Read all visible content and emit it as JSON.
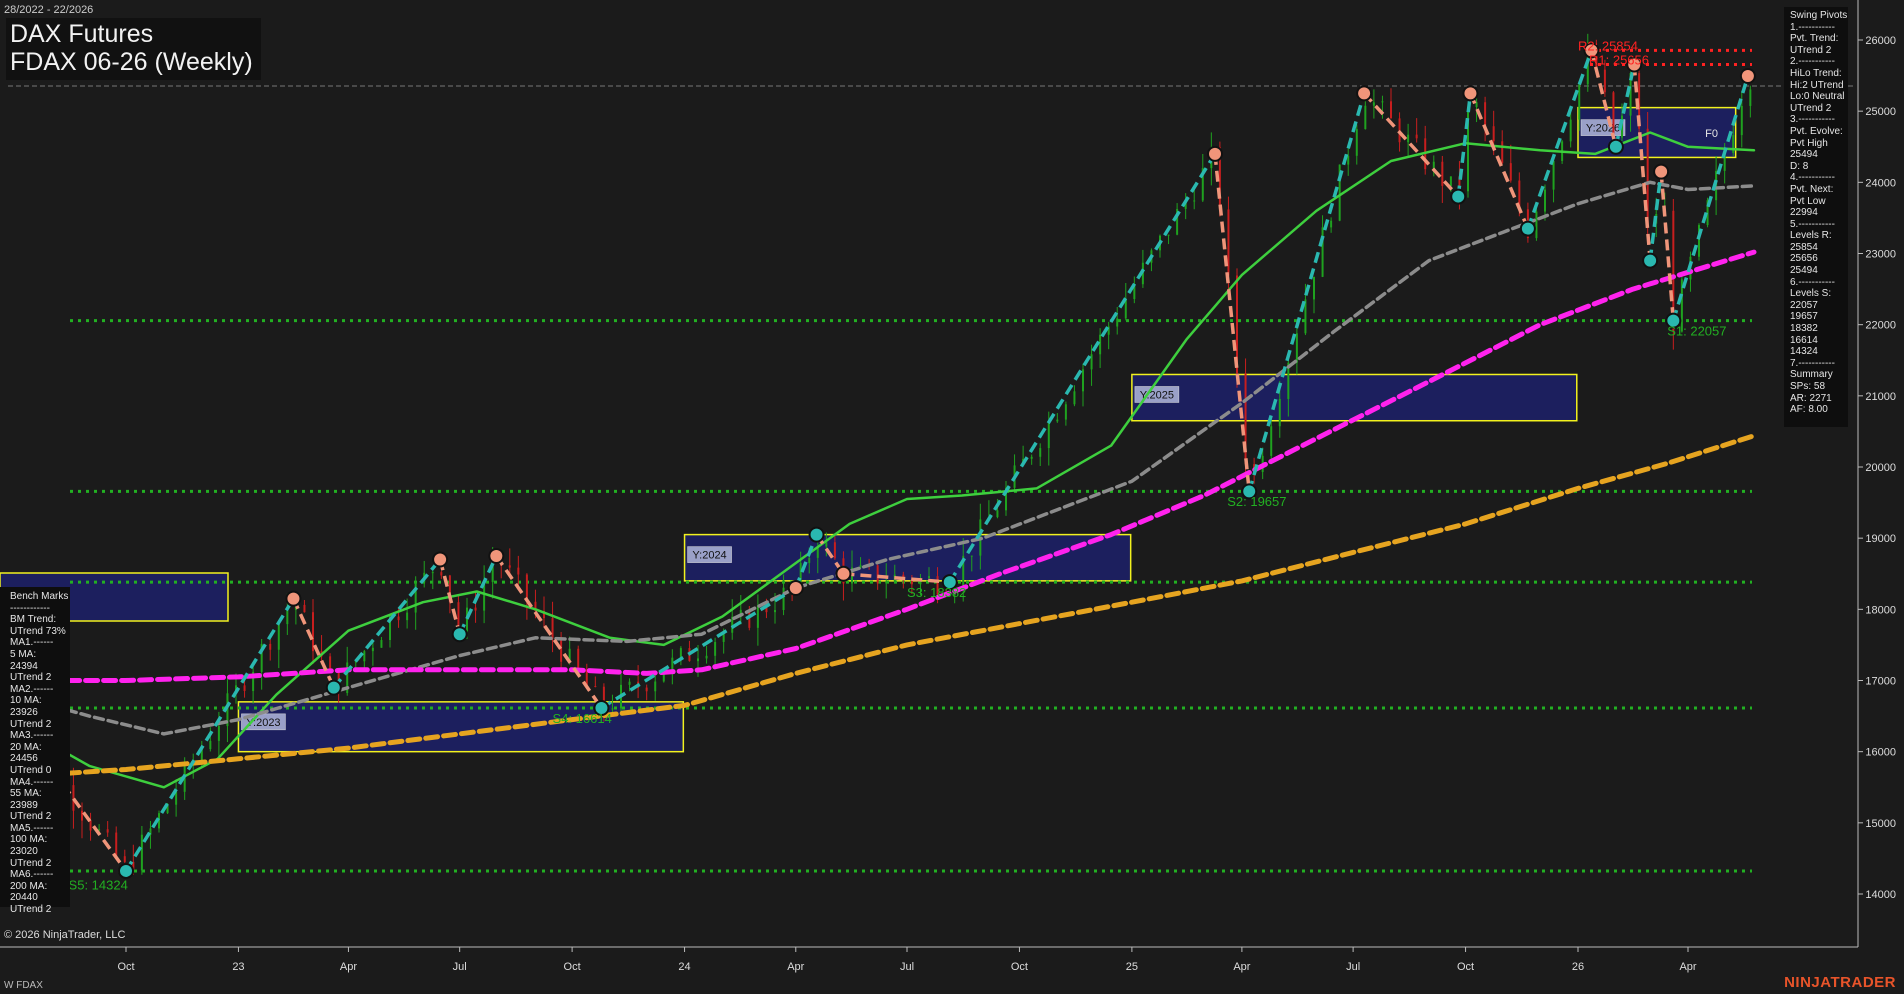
{
  "header": {
    "date_range": "28/2022 - 22/2026",
    "title_line1": "DAX Futures",
    "title_line2": "FDAX 06-26 (Weekly)"
  },
  "footer": {
    "copyright": "© 2026 NinjaTrader, LLC",
    "instrument": "W FDAX",
    "brand": "NINJATRADER"
  },
  "bench_marks": [
    "Bench Marks",
    "------------",
    "BM Trend:",
    "UTrend 73%",
    "MA1.------",
    "5 MA:",
    "24394",
    "UTrend 2",
    "MA2.------",
    "10 MA:",
    "23926",
    "UTrend 2",
    "MA3.------",
    "20 MA:",
    "24456",
    "UTrend 0",
    "MA4.------",
    "55 MA:",
    "23989",
    "UTrend 2",
    "MA5.------",
    "100 MA:",
    "23020",
    "UTrend 2",
    "MA6.------",
    "200 MA:",
    "20440",
    "UTrend 2"
  ],
  "swing_pivots": [
    "Swing Pivots",
    "1.-----------",
    "Pvt. Trend:",
    "UTrend 2",
    "2.-----------",
    "HiLo Trend:",
    "Hi:2 UTrend",
    "Lo:0 Neutral",
    "UTrend 2",
    "3.-----------",
    "Pvt. Evolve:",
    "Pvt High",
    "25494",
    "D: 8",
    "4.-----------",
    "Pvt. Next:",
    "Pvt Low",
    "22994",
    "5.-----------",
    "Levels R:",
    "25854",
    "25656",
    "25494",
    "6.-----------",
    "Levels S:",
    "22057",
    "19657",
    "18382",
    "16614",
    "14324",
    "7.-----------",
    "Summary",
    "SPs: 58",
    "AR: 2271",
    "AF: 8.00"
  ],
  "colors": {
    "background": "#1b1b1b",
    "up_bar": "#1fa21f",
    "down_bar": "#c81e1e",
    "ma_green": "#3ecf3e",
    "ma_gray": "#8c8c8c",
    "ma_magenta": "#ff22ee",
    "ma_orange": "#e6a420",
    "swing_up": "#2ab8b0",
    "swing_down": "#f0957a",
    "resistance": "#ff2222",
    "support": "#22b022",
    "zone_fill": "#1c1f5e",
    "zone_border": "#f2f21e"
  },
  "chart_data": {
    "type": "candlestick",
    "title": "FDAX 06-26 (Weekly)",
    "ylim": [
      13600,
      26400
    ],
    "y_ticks": [
      14000,
      15000,
      16000,
      17000,
      18000,
      19000,
      20000,
      21000,
      22000,
      23000,
      24000,
      25000,
      26000
    ],
    "x_ticks": [
      {
        "label": "Oct",
        "date": "2022-10-01"
      },
      {
        "label": "23",
        "date": "2023-01-01"
      },
      {
        "label": "Apr",
        "date": "2023-04-01"
      },
      {
        "label": "Jul",
        "date": "2023-07-01"
      },
      {
        "label": "Oct",
        "date": "2023-10-01"
      },
      {
        "label": "24",
        "date": "2024-01-01"
      },
      {
        "label": "Apr",
        "date": "2024-04-01"
      },
      {
        "label": "Jul",
        "date": "2024-07-01"
      },
      {
        "label": "Oct",
        "date": "2024-10-01"
      },
      {
        "label": "25",
        "date": "2025-01-01"
      },
      {
        "label": "Apr",
        "date": "2025-04-01"
      },
      {
        "label": "Jul",
        "date": "2025-07-01"
      },
      {
        "label": "Oct",
        "date": "2025-10-01"
      },
      {
        "label": "26",
        "date": "2026-01-01"
      },
      {
        "label": "Apr",
        "date": "2026-04-01"
      }
    ],
    "swing_pivots": [
      {
        "date": "2022-07-01",
        "value": 16500,
        "type": "H"
      },
      {
        "date": "2022-10-01",
        "value": 14324,
        "type": "L"
      },
      {
        "date": "2023-02-15",
        "value": 18150,
        "type": "H"
      },
      {
        "date": "2023-03-20",
        "value": 16900,
        "type": "L"
      },
      {
        "date": "2023-06-15",
        "value": 18700,
        "type": "H"
      },
      {
        "date": "2023-07-01",
        "value": 17650,
        "type": "L"
      },
      {
        "date": "2023-07-31",
        "value": 18750,
        "type": "H"
      },
      {
        "date": "2023-10-25",
        "value": 16614,
        "type": "L"
      },
      {
        "date": "2024-04-01",
        "value": 18300,
        "type": "H"
      },
      {
        "date": "2024-04-18",
        "value": 19050,
        "type": "L"
      },
      {
        "date": "2024-05-10",
        "value": 18500,
        "type": "H"
      },
      {
        "date": "2024-08-05",
        "value": 18382,
        "type": "L"
      },
      {
        "date": "2025-03-10",
        "value": 24400,
        "type": "H"
      },
      {
        "date": "2025-04-07",
        "value": 19657,
        "type": "L"
      },
      {
        "date": "2025-07-10",
        "value": 25250,
        "type": "H"
      },
      {
        "date": "2025-09-25",
        "value": 23800,
        "type": "L"
      },
      {
        "date": "2025-10-05",
        "value": 25250,
        "type": "H"
      },
      {
        "date": "2025-11-21",
        "value": 23350,
        "type": "L"
      },
      {
        "date": "2026-01-12",
        "value": 25854,
        "type": "H"
      },
      {
        "date": "2026-02-01",
        "value": 24500,
        "type": "L"
      },
      {
        "date": "2026-02-16",
        "value": 25656,
        "type": "H"
      },
      {
        "date": "2026-03-01",
        "value": 22900,
        "type": "L"
      },
      {
        "date": "2026-03-10",
        "value": 24150,
        "type": "H"
      },
      {
        "date": "2026-03-20",
        "value": 22057,
        "type": "L"
      },
      {
        "date": "2026-05-20",
        "value": 25494,
        "type": "H"
      }
    ],
    "moving_averages": [
      {
        "name": "20 MA",
        "color": "#3ecf3e",
        "style": "solid",
        "points": [
          [
            "2022-07-01",
            16400
          ],
          [
            "2022-09-01",
            15800
          ],
          [
            "2022-11-01",
            15500
          ],
          [
            "2022-12-15",
            15900
          ],
          [
            "2023-02-01",
            16800
          ],
          [
            "2023-04-01",
            17700
          ],
          [
            "2023-06-01",
            18100
          ],
          [
            "2023-07-15",
            18250
          ],
          [
            "2023-09-01",
            18000
          ],
          [
            "2023-11-01",
            17600
          ],
          [
            "2023-12-15",
            17500
          ],
          [
            "2024-02-01",
            17900
          ],
          [
            "2024-03-20",
            18500
          ],
          [
            "2024-05-15",
            19200
          ],
          [
            "2024-07-01",
            19550
          ],
          [
            "2024-08-15",
            19600
          ],
          [
            "2024-10-15",
            19700
          ],
          [
            "2024-12-15",
            20300
          ],
          [
            "2025-02-15",
            21800
          ],
          [
            "2025-04-01",
            22700
          ],
          [
            "2025-06-01",
            23600
          ],
          [
            "2025-08-01",
            24300
          ],
          [
            "2025-10-01",
            24550
          ],
          [
            "2025-12-01",
            24450
          ],
          [
            "2026-01-15",
            24400
          ],
          [
            "2026-03-01",
            24700
          ],
          [
            "2026-04-01",
            24500
          ],
          [
            "2026-05-25",
            24450
          ]
        ]
      },
      {
        "name": "55 MA",
        "color": "#8c8c8c",
        "style": "dashed",
        "points": [
          [
            "2022-07-01",
            16800
          ],
          [
            "2022-09-01",
            16500
          ],
          [
            "2022-11-01",
            16250
          ],
          [
            "2023-01-01",
            16450
          ],
          [
            "2023-04-01",
            16900
          ],
          [
            "2023-07-01",
            17350
          ],
          [
            "2023-09-01",
            17600
          ],
          [
            "2023-11-15",
            17550
          ],
          [
            "2024-01-15",
            17650
          ],
          [
            "2024-04-01",
            18300
          ],
          [
            "2024-06-15",
            18700
          ],
          [
            "2024-09-01",
            19000
          ],
          [
            "2024-11-01",
            19400
          ],
          [
            "2025-01-01",
            19800
          ],
          [
            "2025-04-01",
            20900
          ],
          [
            "2025-06-15",
            21900
          ],
          [
            "2025-09-01",
            22900
          ],
          [
            "2025-11-01",
            23300
          ],
          [
            "2026-01-01",
            23700
          ],
          [
            "2026-03-01",
            24000
          ],
          [
            "2026-04-01",
            23900
          ],
          [
            "2026-05-25",
            23950
          ]
        ]
      },
      {
        "name": "100 MA",
        "color": "#ff22ee",
        "style": "dashed",
        "points": [
          [
            "2022-07-01",
            17000
          ],
          [
            "2022-10-01",
            17000
          ],
          [
            "2023-01-01",
            17050
          ],
          [
            "2023-04-01",
            17150
          ],
          [
            "2023-07-01",
            17150
          ],
          [
            "2023-10-01",
            17150
          ],
          [
            "2023-12-01",
            17100
          ],
          [
            "2024-01-15",
            17150
          ],
          [
            "2024-04-01",
            17450
          ],
          [
            "2024-07-01",
            18000
          ],
          [
            "2024-09-15",
            18500
          ],
          [
            "2024-12-15",
            19050
          ],
          [
            "2025-03-01",
            19600
          ],
          [
            "2025-06-01",
            20400
          ],
          [
            "2025-09-01",
            21200
          ],
          [
            "2025-12-01",
            22000
          ],
          [
            "2026-02-15",
            22500
          ],
          [
            "2026-05-25",
            23020
          ]
        ]
      },
      {
        "name": "200 MA",
        "color": "#e6a420",
        "style": "dashed",
        "points": [
          [
            "2022-07-01",
            15650
          ],
          [
            "2022-10-01",
            15750
          ],
          [
            "2023-01-01",
            15900
          ],
          [
            "2023-04-01",
            16050
          ],
          [
            "2023-07-01",
            16250
          ],
          [
            "2023-10-01",
            16450
          ],
          [
            "2024-01-01",
            16650
          ],
          [
            "2024-04-01",
            17100
          ],
          [
            "2024-07-01",
            17500
          ],
          [
            "2024-10-01",
            17800
          ],
          [
            "2025-01-01",
            18100
          ],
          [
            "2025-04-01",
            18400
          ],
          [
            "2025-07-01",
            18800
          ],
          [
            "2025-10-01",
            19200
          ],
          [
            "2026-01-01",
            19700
          ],
          [
            "2026-03-15",
            20050
          ],
          [
            "2026-05-25",
            20440
          ]
        ]
      }
    ],
    "resistance_levels": [
      25854,
      25656
    ],
    "support_levels": [
      22057,
      19657,
      18382,
      16614,
      14324
    ],
    "level_labels": [
      {
        "text": "R2: 25854",
        "date": "2026-01-01",
        "value": 25854,
        "color": "#ff2222"
      },
      {
        "text": "R1: 25656",
        "date": "2026-01-10",
        "value": 25656,
        "color": "#ff2222"
      },
      {
        "text": "S1: 22057",
        "date": "2026-03-15",
        "value": 21850,
        "color": "#22b022"
      },
      {
        "text": "S2: 19657",
        "date": "2025-03-20",
        "value": 19450,
        "color": "#22b022"
      },
      {
        "text": "S3: 18382",
        "date": "2024-07-01",
        "value": 18170,
        "color": "#22b022"
      },
      {
        "text": "S4: 16614",
        "date": "2023-09-15",
        "value": 16400,
        "color": "#22b022"
      },
      {
        "text": "S5: 14324",
        "date": "2022-08-15",
        "value": 14060,
        "color": "#22b022"
      }
    ],
    "year_zones": [
      {
        "label": "Y:2023",
        "start": "2023-01-01",
        "end": "2023-12-31",
        "low": 16000,
        "high": 16700
      },
      {
        "label": "Y:2024",
        "start": "2024-01-01",
        "end": "2024-12-31",
        "low": 18400,
        "high": 19050
      },
      {
        "label": "Y:2025",
        "start": "2025-01-01",
        "end": "2025-12-31",
        "low": 20650,
        "high": 21300
      },
      {
        "label": "Y:2026",
        "start": "2026-01-01",
        "end": "2026-05-10",
        "low": 24350,
        "high": 25050
      }
    ],
    "annotations": [
      {
        "text": "F0",
        "date": "2026-04-15",
        "value": 24640
      }
    ],
    "grid": false
  }
}
